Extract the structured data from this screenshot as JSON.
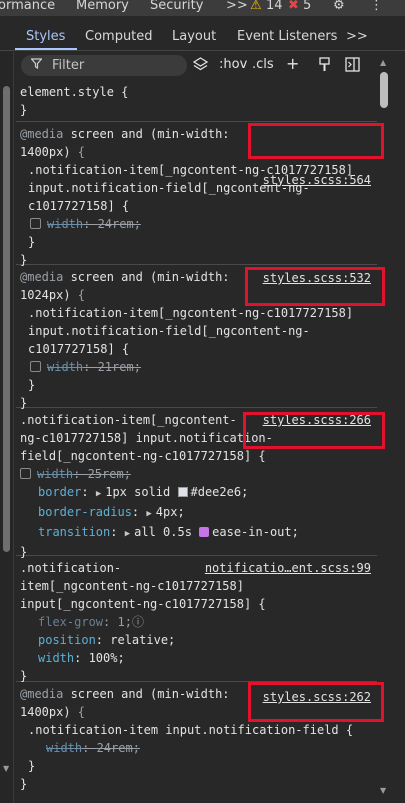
{
  "topbar": {
    "performance_tab": "ormance",
    "memory_tab": "Memory",
    "security_tab": "Security",
    "more_tabs": ">>",
    "warning_count": "14",
    "error_count": "5"
  },
  "subtabs": {
    "styles": "Styles",
    "computed": "Computed",
    "layout": "Layout",
    "event_listeners": "Event Listeners",
    "more": ">>"
  },
  "filter": {
    "placeholder": "Filter",
    "hov": ":hov",
    "cls": ".cls",
    "plus": "+"
  },
  "rules": {
    "element_style": {
      "selector": "element.style {",
      "close": "}"
    },
    "r1": {
      "media1": "@media",
      "media2": " screen and (min-width:",
      "media3": "1400px)",
      "media_brace": " {",
      "source": "styles.scss:564",
      "sel1": ".notification-item[_ngcontent-ng-c1017727158]",
      "sel2": "input.notification-field[_ngcontent-ng-",
      "sel3": "c1017727158] {",
      "prop": "width",
      "val": "24rem;",
      "close_inner": "}",
      "close_outer": "}"
    },
    "r2": {
      "media1": "@media",
      "media2": " screen and (min-width:",
      "media3": "1024px)",
      "media_brace": " {",
      "source": "styles.scss:532",
      "sel1": ".notification-item[_ngcontent-ng-c1017727158]",
      "sel2": "input.notification-field[_ngcontent-ng-",
      "sel3": "c1017727158] {",
      "prop": "width",
      "val": "21rem;",
      "close_inner": "}",
      "close_outer": "}"
    },
    "r3": {
      "sel1": ".notification-item[_ngcontent-",
      "sel2": "ng-c1017727158] input.notification-",
      "sel3": "field[_ngcontent-ng-c1017727158] {",
      "source": "styles.scss:266",
      "width_prop": "width",
      "width_val": "25rem;",
      "border_prop": "border",
      "border_val1": "1px solid",
      "border_val2": "#dee2e6;",
      "radius_prop": "border-radius",
      "radius_val": "4px;",
      "transition_prop": "transition",
      "transition_val1": "all 0.5s",
      "transition_val2": "ease-in-out;",
      "close": "}"
    },
    "r4": {
      "sel1": ".notification-",
      "sel2": "item[_ngcontent-ng-c1017727158]",
      "sel3": "input[_ngcontent-ng-c1017727158] {",
      "source": "notificatio…ent.scss:99",
      "flex_prop": "flex-grow",
      "flex_val": "1;",
      "position_prop": "position",
      "position_val": "relative;",
      "width_prop": "width",
      "width_val": "100%;",
      "close": "}"
    },
    "r5": {
      "media1": "@media",
      "media2": " screen and (min-width:",
      "media3": "1400px)",
      "media_brace": " {",
      "source": "styles.scss:262",
      "sel1": ".notification-item input.notification-field {",
      "prop": "width",
      "val": "24rem;",
      "close_inner": "}",
      "close_outer": "}"
    }
  },
  "colors": {
    "highlight_box": "#e3112b",
    "border_swatch": "#dee2e6",
    "property": "#5db0d7"
  }
}
